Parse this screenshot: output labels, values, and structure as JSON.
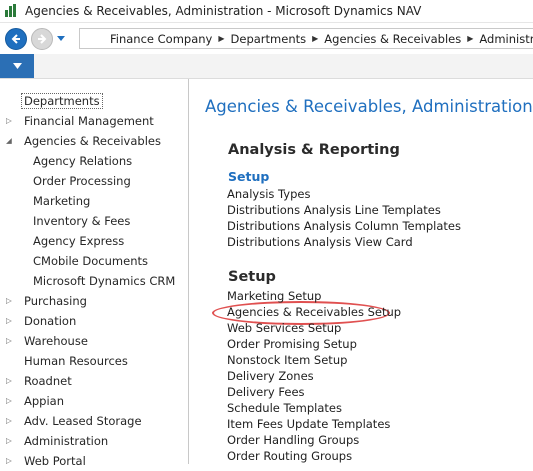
{
  "window": {
    "title": "Agencies & Receivables, Administration - Microsoft Dynamics NAV"
  },
  "navbar": {
    "breadcrumbs": [
      "Finance Company",
      "Departments",
      "Agencies & Receivables",
      "Administration"
    ]
  },
  "navpane": {
    "items": [
      {
        "label": "Departments",
        "level": 0,
        "expander": "none",
        "selected": true
      },
      {
        "label": "Financial Management",
        "level": 0,
        "expander": "collapsed"
      },
      {
        "label": "Agencies & Receivables",
        "level": 0,
        "expander": "expanded"
      },
      {
        "label": "Agency Relations",
        "level": 1
      },
      {
        "label": "Order Processing",
        "level": 1
      },
      {
        "label": "Marketing",
        "level": 1
      },
      {
        "label": "Inventory & Fees",
        "level": 1
      },
      {
        "label": "Agency Express",
        "level": 1
      },
      {
        "label": "CMobile Documents",
        "level": 1
      },
      {
        "label": "Microsoft Dynamics CRM",
        "level": 1
      },
      {
        "label": "Purchasing",
        "level": 0,
        "expander": "collapsed"
      },
      {
        "label": "Donation",
        "level": 0,
        "expander": "collapsed"
      },
      {
        "label": "Warehouse",
        "level": 0,
        "expander": "collapsed"
      },
      {
        "label": "Human Resources",
        "level": 0,
        "expander": "none"
      },
      {
        "label": "Roadnet",
        "level": 0,
        "expander": "collapsed"
      },
      {
        "label": "Appian",
        "level": 0,
        "expander": "collapsed"
      },
      {
        "label": "Adv. Leased Storage",
        "level": 0,
        "expander": "collapsed"
      },
      {
        "label": "Administration",
        "level": 0,
        "expander": "collapsed"
      },
      {
        "label": "Web Portal",
        "level": 0,
        "expander": "collapsed"
      }
    ]
  },
  "main": {
    "title": "Agencies & Receivables, Administration",
    "analysis": {
      "heading": "Analysis & Reporting",
      "setup_label": "Setup",
      "links": [
        "Analysis Types",
        "Distributions Analysis Line Templates",
        "Distributions Analysis Column Templates",
        "Distributions Analysis View Card"
      ]
    },
    "setup": {
      "heading": "Setup",
      "links": [
        "Marketing Setup",
        "Agencies & Receivables Setup",
        "Web Services Setup",
        "Order Promising Setup",
        "Nonstock Item Setup",
        "Delivery Zones",
        "Delivery Fees",
        "Schedule Templates",
        "Item Fees Update Templates",
        "Order Handling Groups",
        "Order Routing Groups"
      ],
      "highlighted": "Agencies & Receivables Setup"
    }
  },
  "colors": {
    "accent": "#1f6fbf",
    "highlight_ring": "#e05050"
  },
  "icons": [
    "app-icon",
    "back-arrow-icon",
    "forward-arrow-icon",
    "nav-dropdown-icon",
    "ribbon-dropdown-icon",
    "breadcrumb-separator-icon",
    "expand-triangle-icon",
    "collapse-triangle-icon"
  ]
}
